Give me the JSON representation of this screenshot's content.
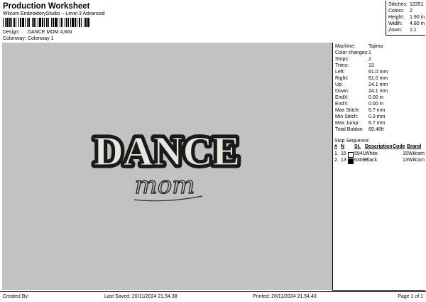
{
  "header": {
    "title": "Production Worksheet",
    "subtitle": "Wilcom EmbroideryStudio – Level 3 Advanced",
    "design_label": "Design:",
    "design_value": "DANCE MOM 4,8IN",
    "colorway_label": "Colonway:",
    "colorway_value": "Colonway 1"
  },
  "stats": [
    {
      "label": "Stitches:",
      "value": "12251"
    },
    {
      "label": "Colors:",
      "value": "2"
    },
    {
      "label": "Height:",
      "value": "1.90 in"
    },
    {
      "label": "Width:",
      "value": "4.80 in"
    },
    {
      "label": "Zoom:",
      "value": "1:1"
    }
  ],
  "design_preview": {
    "main_text": "DANCE",
    "script_text": "mom",
    "fill_color": "#e6e8df",
    "outline_color": "#1a1a1a",
    "canvas_color": "#c2c2c2"
  },
  "machine_info": [
    {
      "label": "Machine:",
      "value": "Tajima"
    },
    {
      "label": "Color changes:",
      "value": "1"
    },
    {
      "label": "Stops:",
      "value": "2"
    },
    {
      "label": "Trims:",
      "value": "13"
    },
    {
      "label": "Left:",
      "value": "61.0 mm"
    },
    {
      "label": "Right:",
      "value": "61.0 mm"
    },
    {
      "label": "Up:",
      "value": "24.1 mm"
    },
    {
      "label": "Down:",
      "value": "24.1 mm"
    },
    {
      "label": "EndX:",
      "value": "0.00 in"
    },
    {
      "label": "EndY:",
      "value": "0.00 in"
    },
    {
      "label": "Max Stitch:",
      "value": "6.7 mm"
    },
    {
      "label": "Min Stitch:",
      "value": "0.3 mm"
    },
    {
      "label": "Max Jump:",
      "value": "6.7 mm"
    },
    {
      "label": "Total Bobbin:",
      "value": "69.46ft"
    }
  ],
  "stop_sequence": {
    "title": "Stop Sequence:",
    "columns": [
      "#",
      "N",
      "St.",
      "Description",
      "Code",
      "Brand"
    ],
    "rows": [
      {
        "num": "1.",
        "n": "15",
        "swatch": "#ffffff",
        "st": "5941",
        "description": "White",
        "code": "15",
        "brand": "Wilcom"
      },
      {
        "num": "2.",
        "n": "13",
        "swatch": "#000000",
        "st": "6308",
        "description": "Black",
        "code": "13",
        "brand": "Wilcom"
      }
    ]
  },
  "footer": {
    "created_by": "Created By:",
    "last_saved": "Last Saved: 20/11/2024 21.54.38",
    "printed": "Printed: 20/11/2024 21.54.40",
    "page": "Page 1 of 1"
  }
}
